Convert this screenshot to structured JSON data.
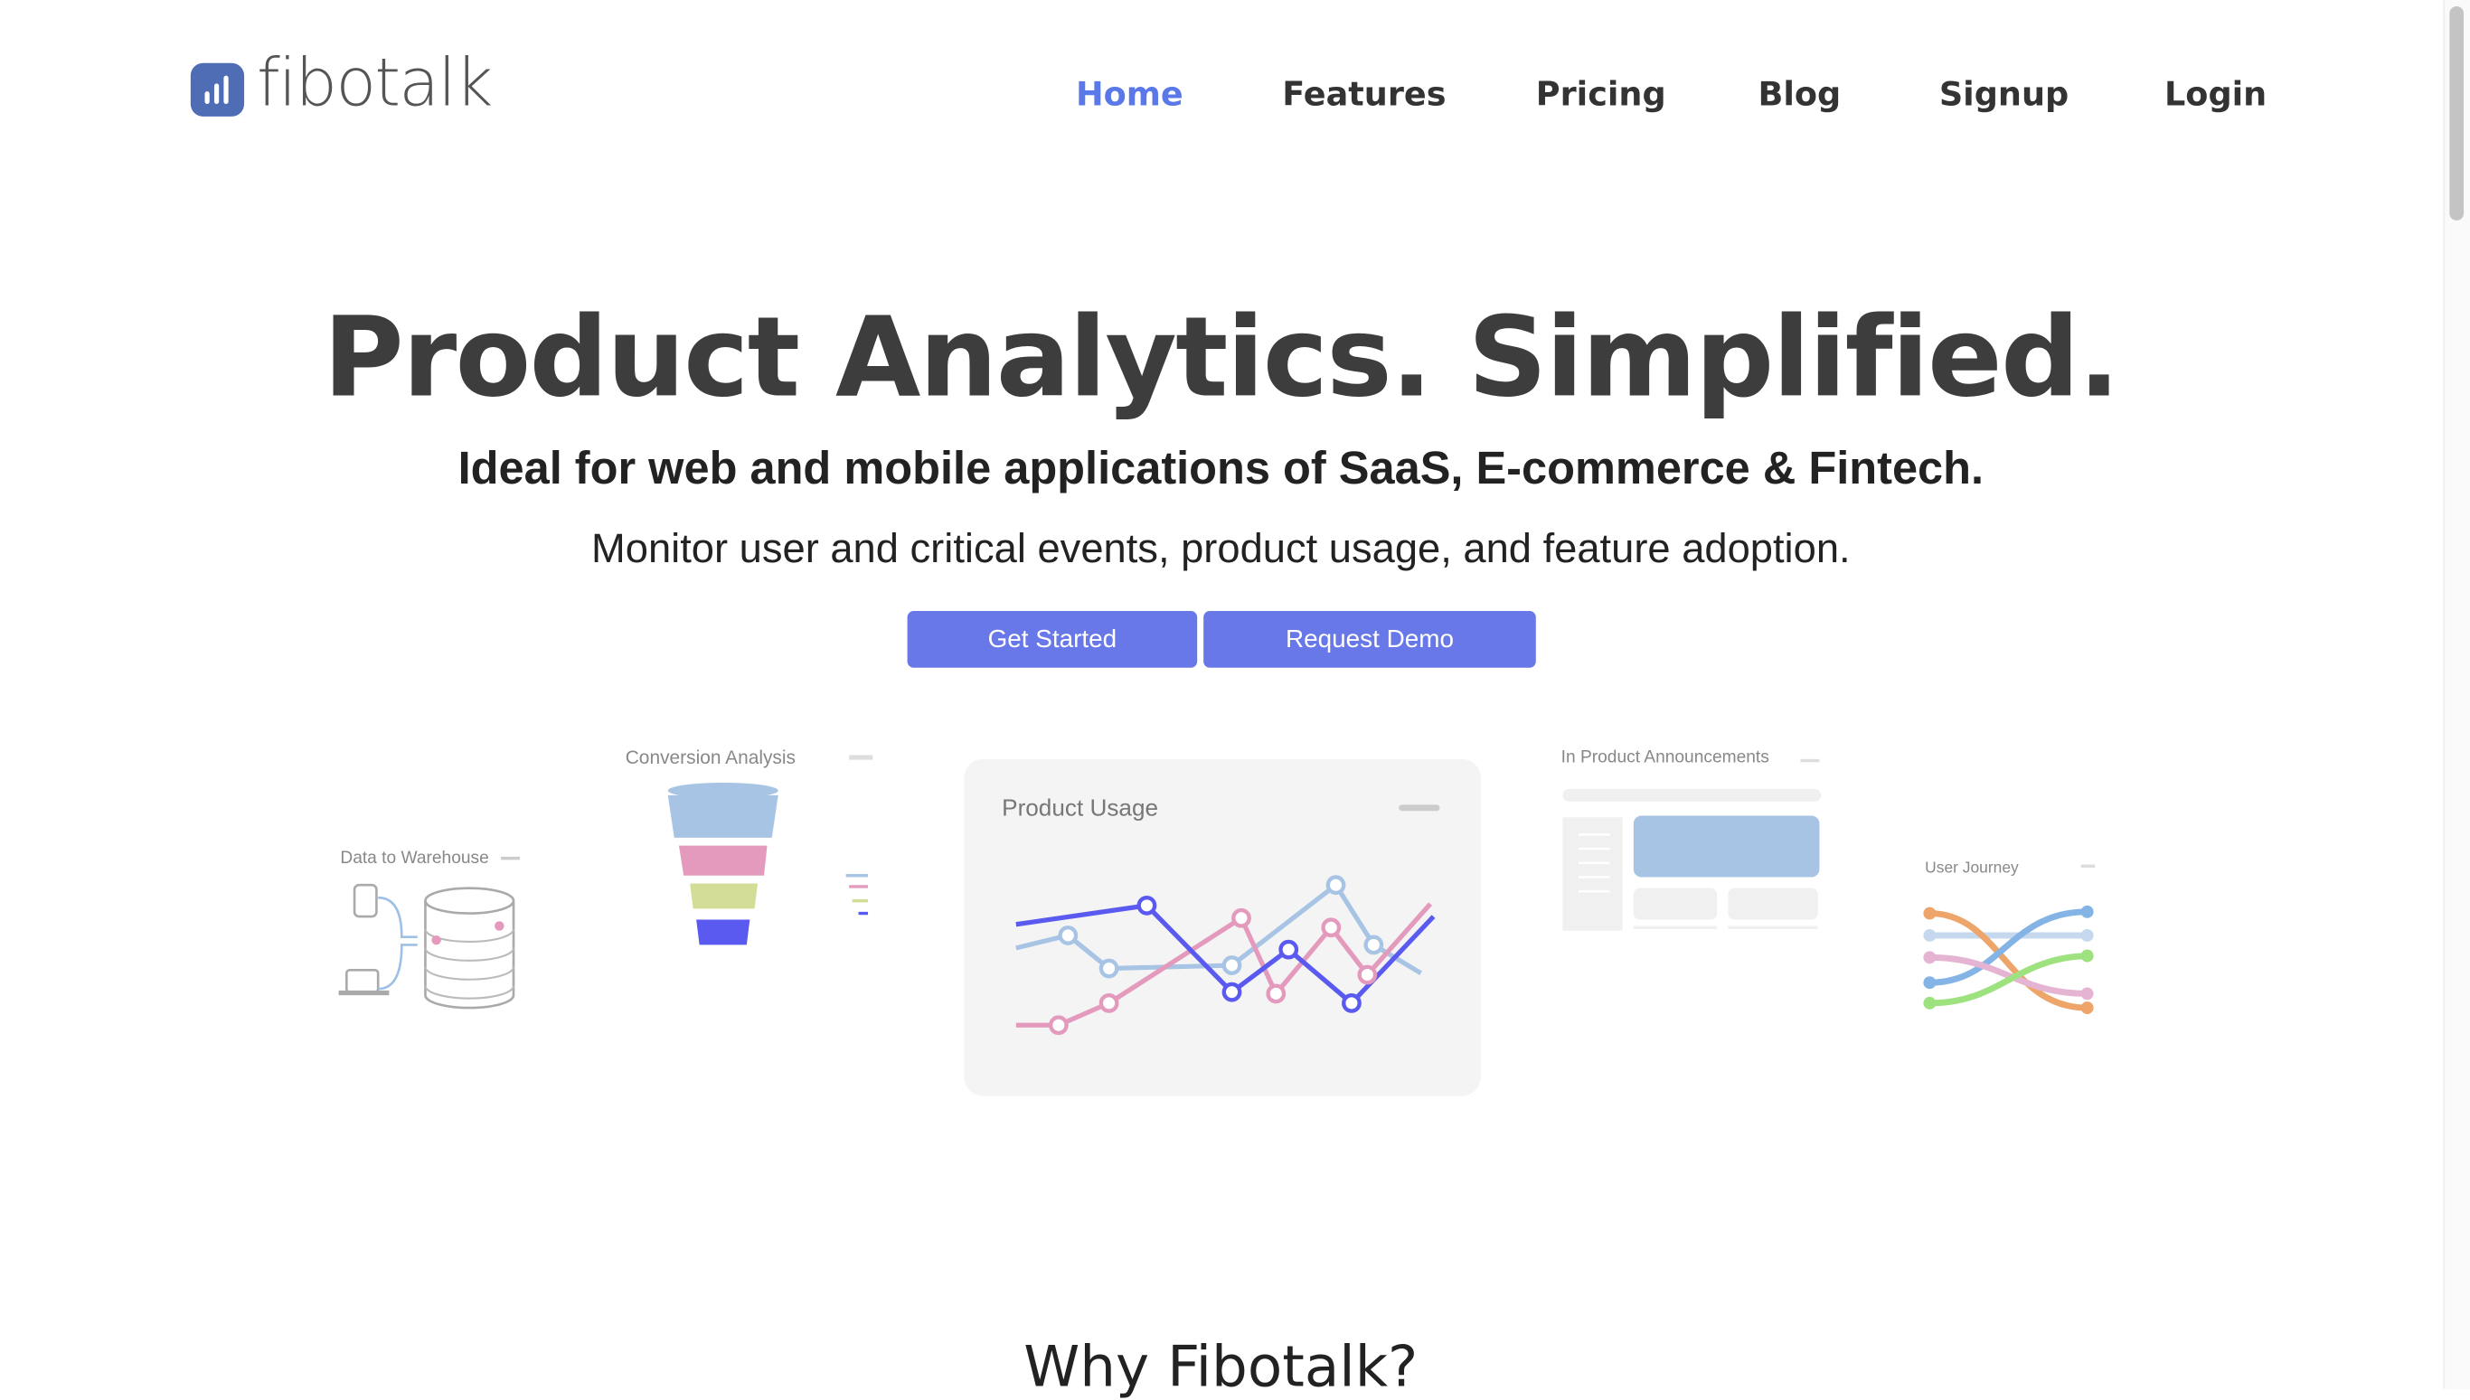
{
  "brand": {
    "name": "fibotalk",
    "logo_color": "#4f6db5"
  },
  "nav": {
    "items": [
      {
        "label": "Home",
        "active": true
      },
      {
        "label": "Features"
      },
      {
        "label": "Pricing"
      },
      {
        "label": "Blog"
      },
      {
        "label": "Signup"
      },
      {
        "label": "Login"
      }
    ],
    "active_color": "#5a78e8"
  },
  "hero": {
    "title": "Product Analytics. Simplified.",
    "subtitle": "Ideal for web and mobile applications of SaaS, E-commerce & Fintech.",
    "tagline": "Monitor user and critical events, product usage, and feature adoption.",
    "get_started": "Get Started",
    "request_demo": "Request Demo",
    "button_color": "#6878e8"
  },
  "illustrations": {
    "warehouse": "Data to Warehouse",
    "conversion": "Conversion Analysis",
    "usage": "Product Usage",
    "announcements": "In Product Announcements",
    "journey": "User Journey"
  },
  "section": {
    "why_title": "Why Fibotalk?"
  }
}
